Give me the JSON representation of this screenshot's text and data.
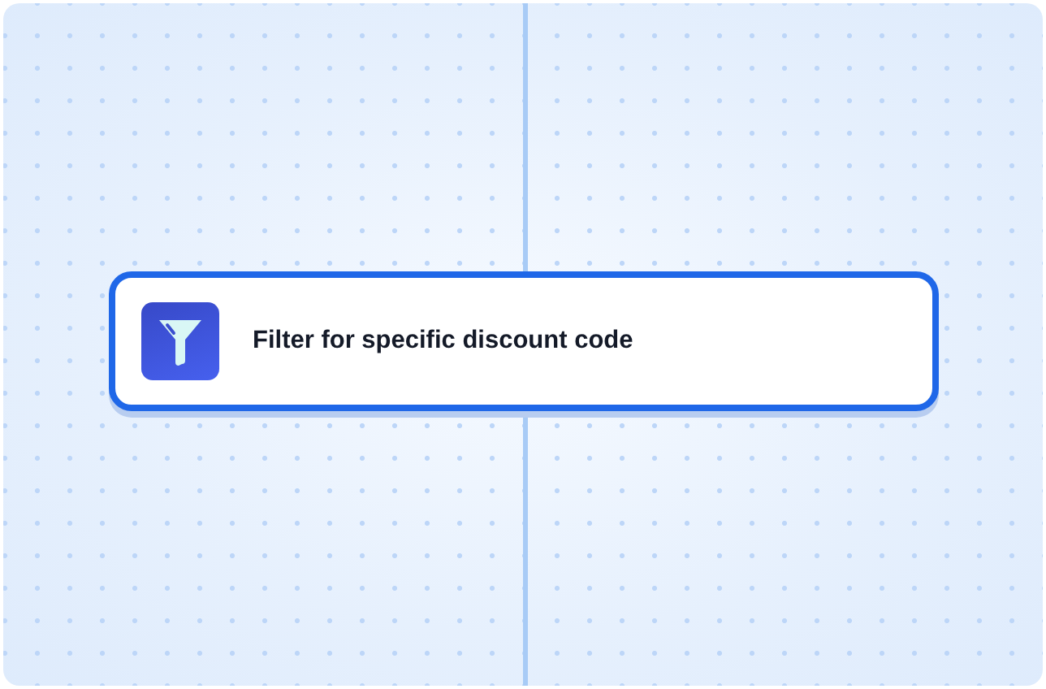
{
  "node": {
    "title": "Filter for specific discount code"
  }
}
